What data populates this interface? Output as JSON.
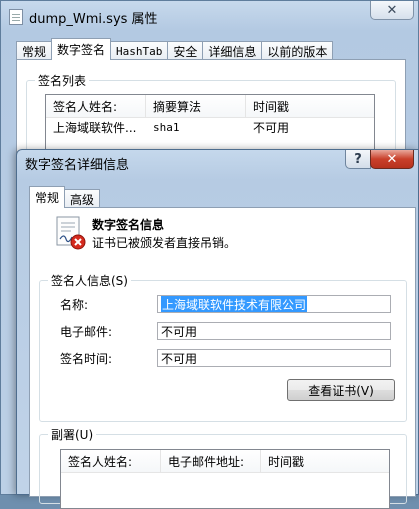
{
  "back_window": {
    "title": "dump_Wmi.sys 属性",
    "close_glyph": "✕",
    "tabs": [
      {
        "label": "常规"
      },
      {
        "label": "数字签名"
      },
      {
        "label": "HashTab"
      },
      {
        "label": "安全"
      },
      {
        "label": "详细信息"
      },
      {
        "label": "以前的版本"
      }
    ],
    "active_tab": "数字签名",
    "signature_list": {
      "group_label": "签名列表",
      "columns": [
        "签名人姓名:",
        "摘要算法",
        "时间戳"
      ],
      "rows": [
        {
          "signer": "上海域联软件...",
          "digest": "sha1",
          "timestamp": "不可用"
        }
      ]
    }
  },
  "front_dialog": {
    "title": "数字签名详细信息",
    "help_glyph": "?",
    "close_glyph": "✕",
    "tabs": [
      {
        "label": "常规"
      },
      {
        "label": "高级"
      }
    ],
    "active_tab": "常规",
    "info_title": "数字签名信息",
    "info_desc": "证书已被颁发者直接吊销。",
    "signer_group": {
      "label": "签名人信息(S)",
      "name_label": "名称:",
      "name_value": "上海域联软件技术有限公司",
      "email_label": "电子邮件:",
      "email_value": "不可用",
      "time_label": "签名时间:",
      "time_value": "不可用",
      "view_cert_button": "查看证书(V)"
    },
    "countersign_group": {
      "label": "副署(U)",
      "columns": [
        "签名人姓名:",
        "电子邮件地址:",
        "时间戳"
      ]
    }
  },
  "colors": {
    "selection": "#3399ff",
    "close_red": "#c9402b",
    "revoked_red": "#d42a1e"
  }
}
